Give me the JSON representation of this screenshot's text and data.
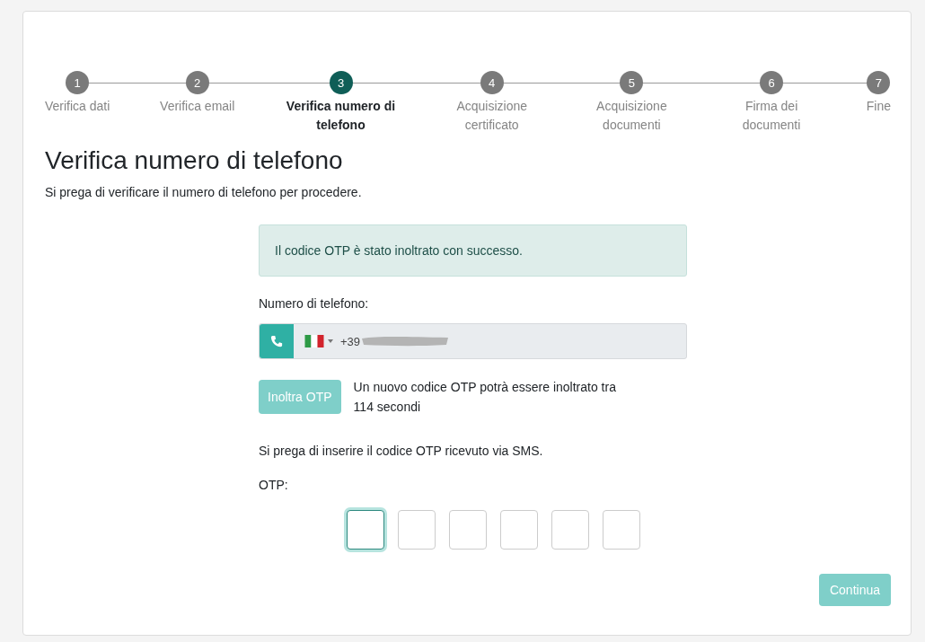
{
  "steps": [
    {
      "number": "1",
      "label": "Verifica dati",
      "selected": false
    },
    {
      "number": "2",
      "label": "Verifica email",
      "selected": false
    },
    {
      "number": "3",
      "label": "Verifica numero di telefono",
      "selected": true
    },
    {
      "number": "4",
      "label": "Acquisizione certificato",
      "selected": false
    },
    {
      "number": "5",
      "label": "Acquisizione documenti",
      "selected": false
    },
    {
      "number": "6",
      "label": "Firma dei documenti",
      "selected": false
    },
    {
      "number": "7",
      "label": "Fine",
      "selected": false
    }
  ],
  "heading": "Verifica numero di telefono",
  "intro": "Si prega di verificare il numero di telefono per procedere.",
  "alert": "Il codice OTP è stato inoltrato con successo.",
  "phone": {
    "label": "Numero di telefono:",
    "value": "+39",
    "redacted": true
  },
  "resend": {
    "button": "Inoltra OTP",
    "disabled": true,
    "message": "Un nuovo codice OTP potrà essere inoltrato tra 114 secondi"
  },
  "instruction": "Si prega di inserire il codice OTP ricevuto via SMS.",
  "otp": {
    "label": "OTP:",
    "boxes": [
      {
        "focused": true
      },
      {
        "focused": false
      },
      {
        "focused": false
      },
      {
        "focused": false
      },
      {
        "focused": false
      },
      {
        "focused": false
      }
    ]
  },
  "continue_button": {
    "label": "Continua",
    "disabled": true
  }
}
